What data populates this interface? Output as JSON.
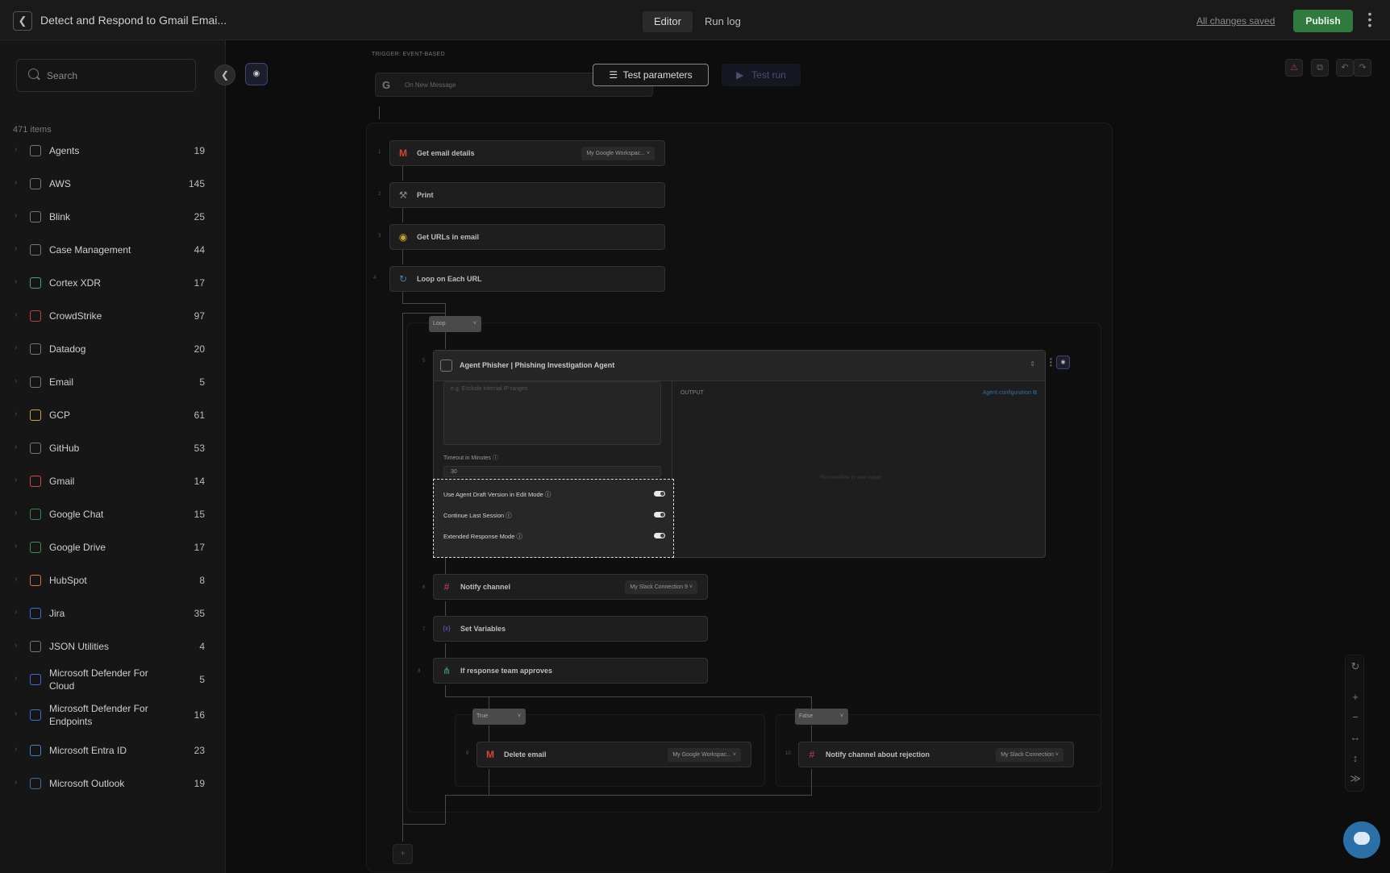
{
  "header": {
    "title": "Detect and Respond to Gmail Emai...",
    "tabs": [
      "Editor",
      "Run log"
    ],
    "saved_status": "All changes saved",
    "publish_label": "Publish"
  },
  "sidebar": {
    "search_placeholder": "Search",
    "items_count": "471 items",
    "categories": [
      {
        "label": "Agents",
        "count": "19",
        "icon": "agent-icon"
      },
      {
        "label": "AWS",
        "count": "145",
        "icon": "aws-icon"
      },
      {
        "label": "Blink",
        "count": "25",
        "icon": "blink-icon"
      },
      {
        "label": "Case Management",
        "count": "44",
        "icon": "case-icon"
      },
      {
        "label": "Cortex XDR",
        "count": "17",
        "icon": "cortex-icon"
      },
      {
        "label": "CrowdStrike",
        "count": "97",
        "icon": "crowdstrike-icon"
      },
      {
        "label": "Datadog",
        "count": "20",
        "icon": "datadog-icon"
      },
      {
        "label": "Email",
        "count": "5",
        "icon": "email-icon"
      },
      {
        "label": "GCP",
        "count": "61",
        "icon": "gcp-icon"
      },
      {
        "label": "GitHub",
        "count": "53",
        "icon": "github-icon"
      },
      {
        "label": "Gmail",
        "count": "14",
        "icon": "gmail-icon"
      },
      {
        "label": "Google Chat",
        "count": "15",
        "icon": "google-chat-icon"
      },
      {
        "label": "Google Drive",
        "count": "17",
        "icon": "google-drive-icon"
      },
      {
        "label": "HubSpot",
        "count": "8",
        "icon": "hubspot-icon"
      },
      {
        "label": "Jira",
        "count": "35",
        "icon": "jira-icon"
      },
      {
        "label": "JSON Utilities",
        "count": "4",
        "icon": "json-icon"
      },
      {
        "label": "Microsoft Defender For Cloud",
        "count": "5",
        "icon": "defender-icon"
      },
      {
        "label": "Microsoft Defender For Endpoints",
        "count": "16",
        "icon": "defender-icon"
      },
      {
        "label": "Microsoft Entra ID",
        "count": "23",
        "icon": "entra-icon"
      },
      {
        "label": "Microsoft Outlook",
        "count": "19",
        "icon": "outlook-icon"
      }
    ]
  },
  "canvas": {
    "trigger_label": "TRIGGER: EVENT-BASED",
    "trigger_text": "On New Message",
    "test_parameters": "Test parameters",
    "test_run": "Test run",
    "steps": {
      "s1": {
        "no": "1",
        "label": "Get email details",
        "conn": "My Google Workspac..."
      },
      "s2": {
        "no": "2",
        "label": "Print"
      },
      "s3": {
        "no": "3",
        "label": "Get URLs in email"
      },
      "s4": {
        "no": "4",
        "label": "Loop on Each URL"
      },
      "s6": {
        "no": "6",
        "label": "Notify channel",
        "conn": "My Slack Connection 9"
      },
      "s7": {
        "no": "7",
        "label": "Set Variables"
      },
      "s8": {
        "no": "8",
        "label": "If response team approves"
      },
      "s9": {
        "no": "9",
        "label": "Delete email",
        "conn": "My Google Workspac..."
      },
      "s10": {
        "no": "10",
        "label": "Notify channel about rejection",
        "conn": "My Slack Connection"
      }
    },
    "loop_pill": "Loop",
    "true_pill": "True",
    "false_pill": "False",
    "agent": {
      "no": "5",
      "title": "Agent Phisher | Phishing Investigation Agent",
      "textarea_placeholder": "e.g. Exclude internal IP ranges",
      "timeout_label": "Timeout in Minutes",
      "timeout_value": "30",
      "output_label": "OUTPUT",
      "agent_config": "Agent configuration",
      "empty_output": "Run workflow to view output",
      "toggles": [
        {
          "label": "Use Agent Draft Version in Edit Mode",
          "on": true
        },
        {
          "label": "Continue Last Session",
          "on": true
        },
        {
          "label": "Extended Response Mode",
          "on": true
        }
      ]
    }
  },
  "colors": {
    "publish": "#2f7a3c",
    "accent_link": "#2f6ea8",
    "chat": "#2b6fa8"
  }
}
